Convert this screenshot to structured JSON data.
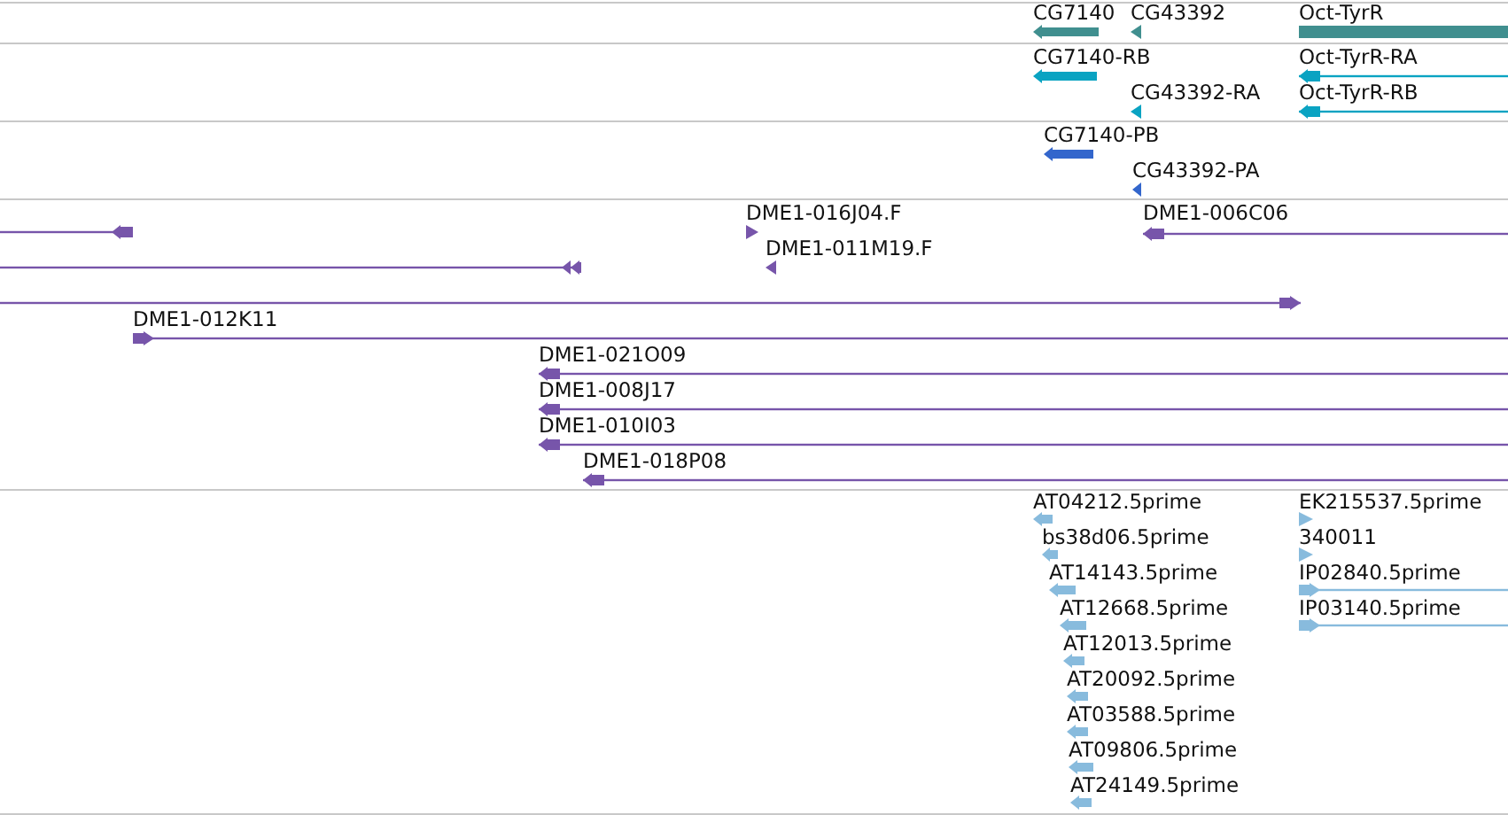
{
  "tracks": [
    {
      "color": "#408f8f",
      "features": [
        {
          "label": "CG7140",
          "kind": "block",
          "reverse": true
        },
        {
          "label": "CG43392",
          "kind": "marker",
          "reverse": true
        },
        {
          "label": "Oct-TyrR",
          "kind": "bar"
        }
      ]
    },
    {
      "color": "#0aa3c2",
      "features": [
        {
          "label": "CG7140-RB",
          "kind": "block",
          "reverse": true
        },
        {
          "label": "Oct-TyrR-RA",
          "kind": "line",
          "reverse": true
        },
        {
          "label": "CG43392-RA",
          "kind": "marker",
          "reverse": true
        },
        {
          "label": "Oct-TyrR-RB",
          "kind": "line",
          "reverse": true
        }
      ]
    },
    {
      "color": "#3366cc",
      "features": [
        {
          "label": "CG7140-PB",
          "kind": "block",
          "reverse": true
        },
        {
          "label": "CG43392-PA",
          "kind": "marker",
          "reverse": true
        }
      ]
    },
    {
      "color": "#7755aa",
      "features": [
        {
          "kind": "line",
          "reverse": true
        },
        {
          "label": "DME1-016J04.F",
          "kind": "marker",
          "reverse": false
        },
        {
          "label": "DME1-006C06",
          "kind": "line",
          "reverse": true
        },
        {
          "kind": "double",
          "reverse": true
        },
        {
          "label": "DME1-011M19.F",
          "kind": "marker",
          "reverse": true
        },
        {
          "kind": "line",
          "reverse": false
        },
        {
          "label": "DME1-012K11",
          "kind": "line",
          "reverse": false
        },
        {
          "label": "DME1-021O09",
          "kind": "line",
          "reverse": true
        },
        {
          "label": "DME1-008J17",
          "kind": "line",
          "reverse": true
        },
        {
          "label": "DME1-010I03",
          "kind": "line",
          "reverse": true
        },
        {
          "label": "DME1-018P08",
          "kind": "line",
          "reverse": true
        }
      ]
    },
    {
      "color": "#88bbdd",
      "features": [
        {
          "label": "AT04212.5prime",
          "kind": "block",
          "reverse": true
        },
        {
          "label": "EK215537.5prime",
          "kind": "marker",
          "reverse": false
        },
        {
          "label": "bs38d06.5prime",
          "kind": "block",
          "reverse": true
        },
        {
          "label": "340011",
          "kind": "marker",
          "reverse": false
        },
        {
          "label": "AT14143.5prime",
          "kind": "block",
          "reverse": true
        },
        {
          "label": "IP02840.5prime",
          "kind": "line",
          "reverse": false
        },
        {
          "label": "AT12668.5prime",
          "kind": "block",
          "reverse": true
        },
        {
          "label": "IP03140.5prime",
          "kind": "line",
          "reverse": false
        },
        {
          "label": "AT12013.5prime",
          "kind": "block",
          "reverse": true
        },
        {
          "label": "AT20092.5prime",
          "kind": "block",
          "reverse": true
        },
        {
          "label": "AT03588.5prime",
          "kind": "block",
          "reverse": true
        },
        {
          "label": "AT09806.5prime",
          "kind": "block",
          "reverse": true
        },
        {
          "label": "AT24149.5prime",
          "kind": "block",
          "reverse": true
        }
      ]
    }
  ]
}
